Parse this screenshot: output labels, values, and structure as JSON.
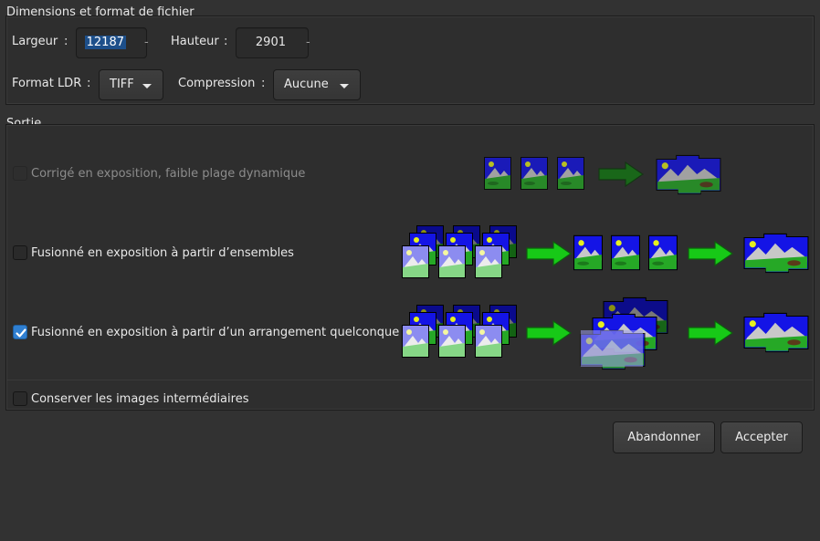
{
  "dimensions": {
    "title": "Dimensions et format de fichier",
    "width_label": "Largeur",
    "width_value": "12187",
    "height_label": "Hauteur",
    "height_value": "2901",
    "colon": ":",
    "spin_dash": "-",
    "ldr_label": "Format LDR",
    "ldr_value": "TIFF",
    "compression_label": "Compression",
    "compression_value": "Aucune"
  },
  "output": {
    "title": "Sortie",
    "options": [
      {
        "label": "Corrigé en exposition, faible plage dynamique",
        "checked": false,
        "enabled": false
      },
      {
        "label": "Fusionné en exposition à partir d’ensembles",
        "checked": false,
        "enabled": true
      },
      {
        "label": "Fusionné en exposition à partir d’un arrangement quelconque",
        "checked": true,
        "enabled": true
      },
      {
        "label": "Conserver les images intermédiaires",
        "checked": false,
        "enabled": true
      }
    ]
  },
  "buttons": {
    "cancel": "Abandonner",
    "accept": "Accepter"
  },
  "colors": {
    "sky": "#1414e6",
    "grass": "#22a422",
    "arrow": "#17c917",
    "accent": "#2f7fd1"
  }
}
